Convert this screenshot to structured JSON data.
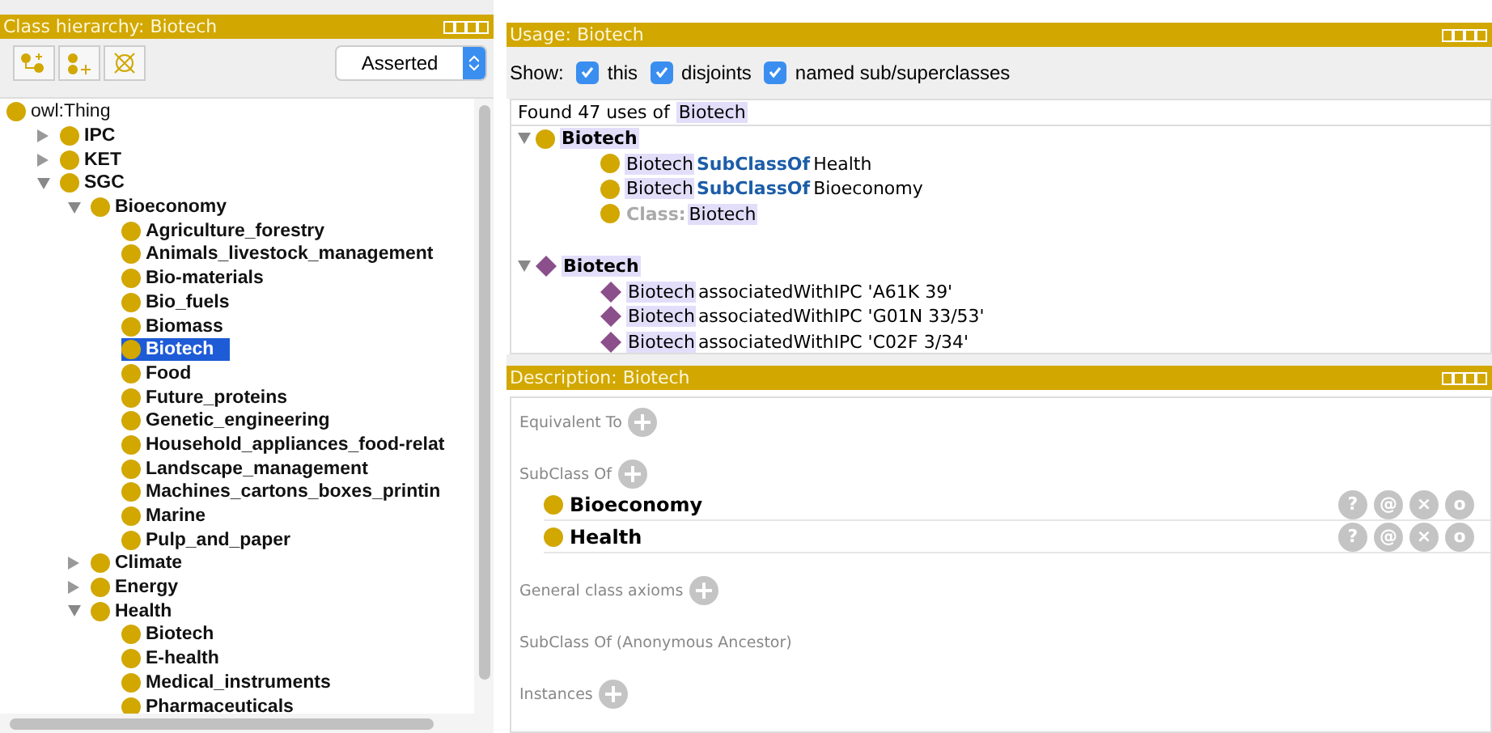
{
  "hierarchy": {
    "title": "Class hierarchy: Biotech",
    "view": "Asserted",
    "tree": [
      {
        "label": "owl:Thing",
        "selected": false,
        "children": [
          {
            "label": "IPC",
            "expanded": false,
            "selected": false
          },
          {
            "label": "KET",
            "expanded": false,
            "selected": false
          },
          {
            "label": "SGC",
            "expanded": true,
            "selected": false,
            "children": [
              {
                "label": "Bioeconomy",
                "expanded": true,
                "selected": false,
                "children": [
                  {
                    "label": "Agriculture_forestry",
                    "selected": false
                  },
                  {
                    "label": "Animals_livestock_management",
                    "selected": false
                  },
                  {
                    "label": "Bio-materials",
                    "selected": false
                  },
                  {
                    "label": "Bio_fuels",
                    "selected": false
                  },
                  {
                    "label": "Biomass",
                    "selected": false
                  },
                  {
                    "label": "Biotech",
                    "selected": true
                  },
                  {
                    "label": "Food",
                    "selected": false
                  },
                  {
                    "label": "Future_proteins",
                    "selected": false
                  },
                  {
                    "label": "Genetic_engineering",
                    "selected": false
                  },
                  {
                    "label": "Household_appliances_food-relat",
                    "selected": false
                  },
                  {
                    "label": "Landscape_management",
                    "selected": false
                  },
                  {
                    "label": "Machines_cartons_boxes_printin",
                    "selected": false
                  },
                  {
                    "label": "Marine",
                    "selected": false
                  },
                  {
                    "label": "Pulp_and_paper",
                    "selected": false
                  }
                ]
              },
              {
                "label": "Climate",
                "expanded": false,
                "selected": false
              },
              {
                "label": "Energy",
                "expanded": false,
                "selected": false
              },
              {
                "label": "Health",
                "expanded": true,
                "selected": false,
                "children": [
                  {
                    "label": "Biotech",
                    "selected": false
                  },
                  {
                    "label": "E-health",
                    "selected": false
                  },
                  {
                    "label": "Medical_instruments",
                    "selected": false
                  },
                  {
                    "label": "Pharmaceuticals",
                    "selected": false
                  }
                ]
              }
            ]
          }
        ]
      }
    ]
  },
  "usage": {
    "title": "Usage: Biotech",
    "show_label": "Show:",
    "filters": [
      {
        "label": "this",
        "checked": true
      },
      {
        "label": "disjoints",
        "checked": true
      },
      {
        "label": "named sub/superclasses",
        "checked": true
      }
    ],
    "summary": [
      {
        "kind": "plain",
        "text": "Found 47 uses of"
      },
      {
        "kind": "entity",
        "text": "Biotech"
      }
    ],
    "groups": [
      {
        "kind": "class",
        "label": "Biotech",
        "expanded": true,
        "items": [
          [
            {
              "kind": "entity",
              "text": "Biotech"
            },
            {
              "kind": "keyword",
              "text": "SubClassOf"
            },
            {
              "kind": "plain",
              "text": "Health"
            }
          ],
          [
            {
              "kind": "entity",
              "text": "Biotech"
            },
            {
              "kind": "keyword",
              "text": "SubClassOf"
            },
            {
              "kind": "plain",
              "text": "Bioeconomy"
            }
          ],
          [
            {
              "kind": "label",
              "text": "Class:"
            },
            {
              "kind": "entity",
              "text": "Biotech"
            }
          ]
        ]
      },
      {
        "kind": "individual",
        "label": "Biotech",
        "expanded": true,
        "items": [
          [
            {
              "kind": "entity",
              "text": "Biotech"
            },
            {
              "kind": "plain",
              "text": "associatedWithIPC 'A61K 39'"
            }
          ],
          [
            {
              "kind": "entity",
              "text": "Biotech"
            },
            {
              "kind": "plain",
              "text": "associatedWithIPC 'G01N 33/53'"
            }
          ],
          [
            {
              "kind": "entity",
              "text": "Biotech"
            },
            {
              "kind": "plain",
              "text": "associatedWithIPC 'C02F 3/34'"
            }
          ]
        ]
      }
    ]
  },
  "description": {
    "title": "Description: Biotech",
    "sections": [
      {
        "title": "Equivalent To",
        "add": true
      },
      {
        "title": "SubClass Of",
        "add": true,
        "items": [
          {
            "label": "Bioeconomy",
            "actions": [
              "?",
              "@",
              "×",
              "o"
            ]
          },
          {
            "label": "Health",
            "actions": [
              "?",
              "@",
              "×",
              "o"
            ]
          }
        ]
      },
      {
        "title": "General class axioms",
        "add": true
      },
      {
        "title": "SubClass Of (Anonymous Ancestor)"
      },
      {
        "title": "Instances",
        "add": true
      }
    ]
  }
}
